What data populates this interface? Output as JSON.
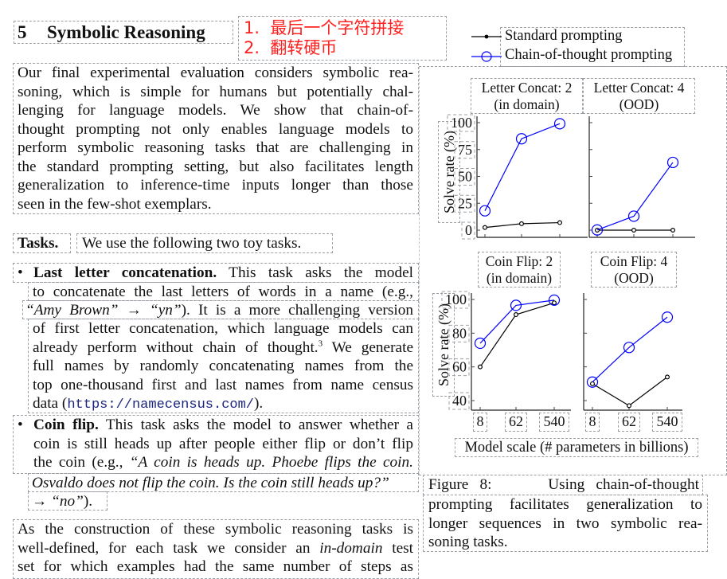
{
  "section": {
    "number": "5",
    "title": "Symbolic Reasoning"
  },
  "annotation": {
    "line1": "1.  最后一个字符拼接",
    "line2": "2.  翻转硬币"
  },
  "intro_paragraph": [
    "Our final experimental evaluation considers symbolic rea-",
    "soning, which is simple for humans but potentially chal-",
    "lenging for language models.  We show that chain-of-",
    "thought prompting not only enables language models to",
    "perform symbolic reasoning tasks that are challenging in",
    "the standard prompting setting, but also facilitates length",
    "generalization to inference-time inputs longer than those",
    "seen in the few-shot exemplars."
  ],
  "tasks": {
    "label": "Tasks.",
    "text": "We use the following two toy tasks."
  },
  "bullet1": {
    "bullet": "•",
    "title": "Last letter concatenation.",
    "line1_rest": " This task asks the model",
    "line2": "to concatenate the last letters of words in a name (e.g.,",
    "line3_italic": "“Amy Brown” → “yn”",
    "line3_rest": "). It is a more challenging version",
    "line4": "of first letter concatenation, which language models can",
    "line5": "already perform without chain of thought.",
    "footnote": "3",
    "line5_rest": " We generate",
    "line6": "full names by randomly concatenating names from the",
    "line7": "top one-thousand first and last names from name census",
    "line8_pre": "data (",
    "line8_url": "https://namecensus.com/",
    "line8_post": ")."
  },
  "bullet2": {
    "bullet": "•",
    "title": "Coin flip.",
    "line1_rest": " This task asks the model to answer whether a",
    "line2": "coin is still heads up after people either flip or don’t flip",
    "line3_pre": "the coin (e.g., ",
    "line3_italic": "“A coin is heads up. Phoebe flips the coin.",
    "line4_italic": "Osvaldo does not flip the coin. Is the coin still heads up?”",
    "line5_arrow": "→ ",
    "line5_italic": "“no”",
    "line5_post": ")."
  },
  "closing_paragraph": {
    "line1": "As the construction of these symbolic reasoning tasks is",
    "line2_pre": "well-defined, for each task we consider an ",
    "line2_italic": "in-domain",
    "line2_post": " test",
    "line3": "set for which examples had the same number of steps as"
  },
  "figure": {
    "caption_line1": "Figure 8:     Using chain-of-thought",
    "caption_lines": [
      "prompting facilitates generalization to",
      "longer sequences in two symbolic rea-",
      "soning tasks."
    ]
  },
  "chart_data": [
    {
      "type": "line",
      "title": "Letter Concat: 2",
      "subtitle": "(in domain)",
      "xlabel": "Model scale (# parameters in billions)",
      "ylabel": "Solve rate (%)",
      "categories": [
        "8",
        "62",
        "540"
      ],
      "ylim": [
        0,
        100
      ],
      "yticks": [
        "0",
        "25",
        "50",
        "75",
        "100"
      ],
      "ytick_values": [
        0,
        25,
        50,
        75,
        100
      ],
      "series": [
        {
          "name": "Standard prompting",
          "color": "#000000",
          "marker": "small-circle",
          "values": [
            2.5,
            6,
            7
          ]
        },
        {
          "name": "Chain-of-thought prompting",
          "color": "#0000ff",
          "marker": "open-circle",
          "values": [
            18,
            85,
            99
          ]
        }
      ]
    },
    {
      "type": "line",
      "title": "Letter Concat: 4",
      "subtitle": "(OOD)",
      "categories": [
        "8",
        "62",
        "540"
      ],
      "ylim": [
        0,
        100
      ],
      "ytick_values": [
        0,
        25,
        50,
        75,
        100
      ],
      "series": [
        {
          "name": "Standard prompting",
          "color": "#000000",
          "marker": "small-circle",
          "values": [
            0,
            0,
            0
          ]
        },
        {
          "name": "Chain-of-thought prompting",
          "color": "#0000ff",
          "marker": "open-circle",
          "values": [
            0.2,
            13,
            63
          ]
        }
      ]
    },
    {
      "type": "line",
      "title": "Coin Flip: 2",
      "subtitle": "(in domain)",
      "ylabel": "Solve rate (%)",
      "categories": [
        "8",
        "62",
        "540"
      ],
      "ylim": [
        40,
        100
      ],
      "yticks": [
        "40",
        "60",
        "80",
        "100"
      ],
      "ytick_values": [
        40,
        60,
        80,
        100
      ],
      "series": [
        {
          "name": "Standard prompting",
          "color": "#000000",
          "marker": "small-circle",
          "values": [
            60,
            91,
            98
          ]
        },
        {
          "name": "Chain-of-thought prompting",
          "color": "#0000ff",
          "marker": "open-circle",
          "values": [
            74,
            96.5,
            99.6
          ]
        }
      ]
    },
    {
      "type": "line",
      "title": "Coin Flip: 4",
      "subtitle": "(OOD)",
      "categories": [
        "8",
        "62",
        "540"
      ],
      "ylim": [
        40,
        100
      ],
      "ytick_values": [
        40,
        60,
        80,
        100
      ],
      "series": [
        {
          "name": "Standard prompting",
          "color": "#000000",
          "marker": "small-circle",
          "values": [
            50,
            37,
            54
          ]
        },
        {
          "name": "Chain-of-thought prompting",
          "color": "#0000ff",
          "marker": "open-circle",
          "values": [
            51,
            71.5,
            89.5
          ]
        }
      ]
    }
  ],
  "legend": {
    "items": [
      {
        "label": "Standard prompting",
        "color": "#000000"
      },
      {
        "label": "Chain-of-thought prompting",
        "color": "#0000ff"
      }
    ]
  }
}
